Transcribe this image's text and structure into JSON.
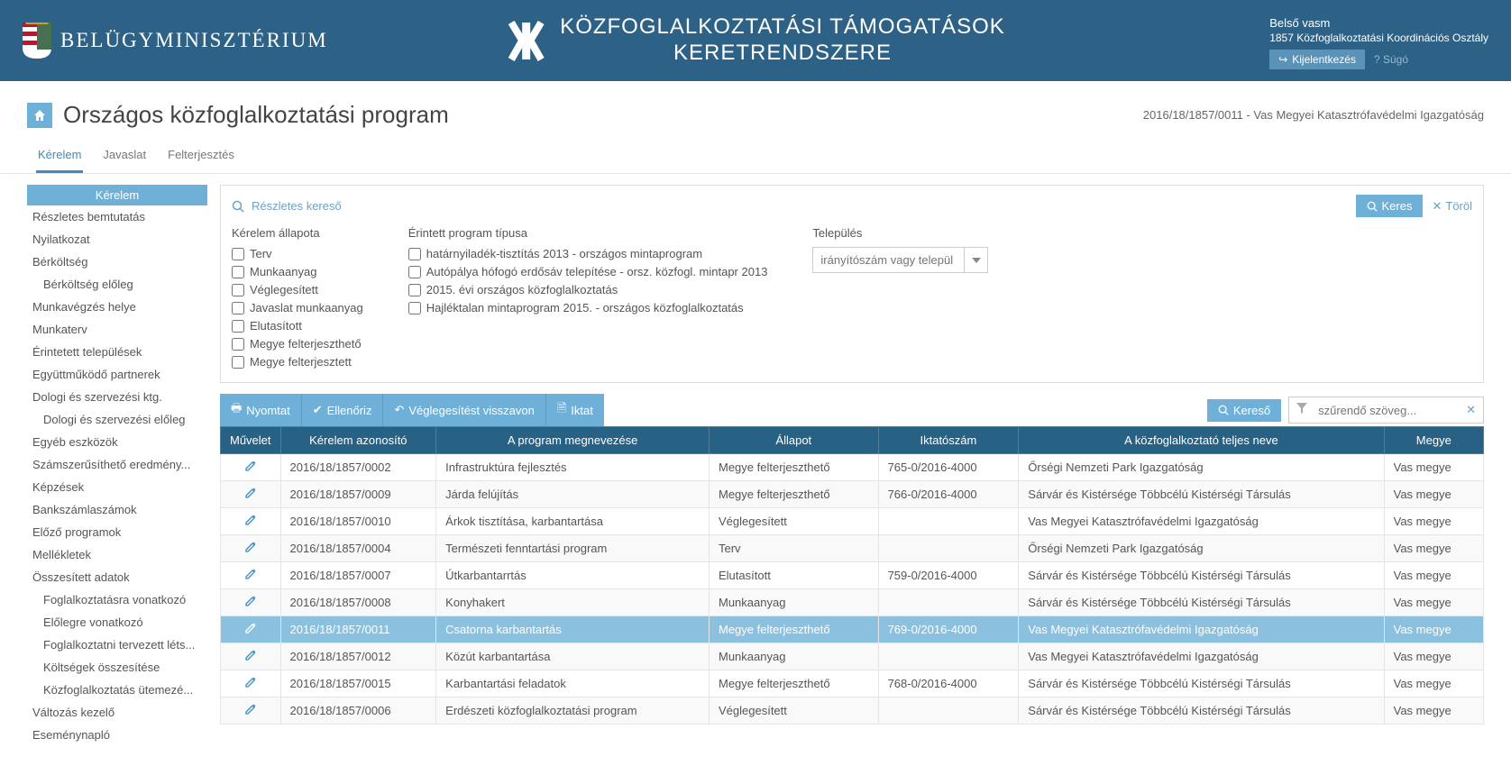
{
  "header": {
    "ministry": "BELÜGYMINISZTÉRIUM",
    "app_title_line1": "KÖZFOGLALKOZTATÁSI TÁMOGATÁSOK",
    "app_title_line2": "KERETRENDSZERE",
    "user_name": "Belső vasm",
    "user_org": "1857 Közfoglalkoztatási Koordinációs Osztály",
    "logout_label": "Kijelentkezés",
    "help_label": "? Súgó"
  },
  "page": {
    "title": "Országos közfoglalkoztatási program",
    "context": "2016/18/1857/0011 - Vas Megyei Katasztrófavédelmi Igazgatóság"
  },
  "tabs": [
    {
      "label": "Kérelem",
      "active": true
    },
    {
      "label": "Javaslat",
      "active": false
    },
    {
      "label": "Felterjesztés",
      "active": false
    }
  ],
  "sidebar": {
    "header": "Kérelem",
    "items": [
      {
        "label": "Részletes bemtutatás"
      },
      {
        "label": "Nyilatkozat"
      },
      {
        "label": "Bérköltség"
      },
      {
        "label": "Bérköltség előleg",
        "indent": true
      },
      {
        "label": "Munkavégzés helye"
      },
      {
        "label": "Munkaterv"
      },
      {
        "label": "Érintetett települések"
      },
      {
        "label": "Együttműködő partnerek"
      },
      {
        "label": "Dologi és szervezési ktg."
      },
      {
        "label": "Dologi és szervezési előleg",
        "indent": true
      },
      {
        "label": "Egyéb eszközök"
      },
      {
        "label": "Számszerűsíthető eredmény..."
      },
      {
        "label": "Képzések"
      },
      {
        "label": "Bankszámlaszámok"
      },
      {
        "label": "Előző programok"
      },
      {
        "label": "Mellékletek"
      },
      {
        "label": "Összesített adatok"
      },
      {
        "label": "Foglalkoztatásra vonatkozó",
        "indent": true
      },
      {
        "label": "Előlegre vonatkozó",
        "indent": true
      },
      {
        "label": "Foglalkoztatni tervezett léts...",
        "indent": true
      },
      {
        "label": "Költségek összesítése",
        "indent": true
      },
      {
        "label": "Közfoglalkoztatás ütemezé...",
        "indent": true
      },
      {
        "label": "Változás kezelő"
      },
      {
        "label": "Eseménynapló"
      }
    ]
  },
  "search": {
    "label": "Részletes kereső",
    "search_btn": "Keres",
    "clear_btn": "Töröl",
    "status_title": "Kérelem állapota",
    "status_options": [
      "Terv",
      "Munkaanyag",
      "Véglegesített",
      "Javaslat munkaanyag",
      "Elutasított",
      "Megye felterjeszthető",
      "Megye felterjesztett"
    ],
    "program_title": "Érintett program típusa",
    "program_options": [
      "határnyiladék-tisztítás 2013 - országos mintaprogram",
      "Autópálya hófogó erdősáv telepítése - orsz. közfogl. mintapr 2013",
      "2015. évi országos közfoglalkoztatás",
      "Hajléktalan mintaprogram 2015. - országos közfoglalkoztatás"
    ],
    "town_title": "Település",
    "town_placeholder": "irányítószám vagy települ"
  },
  "toolbar": {
    "print": "Nyomtat",
    "check": "Ellenőriz",
    "revoke": "Véglegesítést visszavon",
    "file": "Iktat",
    "search": "Kereső",
    "filter_placeholder": "szűrendő szöveg..."
  },
  "table": {
    "headers": [
      "Művelet",
      "Kérelem azonosító",
      "A program megnevezése",
      "Állapot",
      "Iktatószám",
      "A közfoglalkoztató teljes neve",
      "Megye"
    ],
    "rows": [
      {
        "id": "2016/18/1857/0002",
        "name": "Infrastruktúra fejlesztés",
        "status": "Megye felterjeszthető",
        "reg": "765-0/2016-4000",
        "org": "Őrségi Nemzeti Park Igazgatóság",
        "county": "Vas megye"
      },
      {
        "id": "2016/18/1857/0009",
        "name": "Járda felújítás",
        "status": "Megye felterjeszthető",
        "reg": "766-0/2016-4000",
        "org": "Sárvár és Kistérsége Többcélú Kistérségi Társulás",
        "county": "Vas megye"
      },
      {
        "id": "2016/18/1857/0010",
        "name": "Árkok tisztítása, karbantartása",
        "status": "Véglegesített",
        "reg": "",
        "org": "Vas Megyei Katasztrófavédelmi Igazgatóság",
        "county": "Vas megye"
      },
      {
        "id": "2016/18/1857/0004",
        "name": "Természeti fenntartási program",
        "status": "Terv",
        "reg": "",
        "org": "Őrségi Nemzeti Park Igazgatóság",
        "county": "Vas megye"
      },
      {
        "id": "2016/18/1857/0007",
        "name": "Útkarbantarrtás",
        "status": "Elutasított",
        "reg": "759-0/2016-4000",
        "org": "Sárvár és Kistérsége Többcélú Kistérségi Társulás",
        "county": "Vas megye"
      },
      {
        "id": "2016/18/1857/0008",
        "name": "Konyhakert",
        "status": "Munkaanyag",
        "reg": "",
        "org": "Sárvár és Kistérsége Többcélú Kistérségi Társulás",
        "county": "Vas megye"
      },
      {
        "id": "2016/18/1857/0011",
        "name": "Csatorna karbantartás",
        "status": "Megye felterjeszthető",
        "reg": "769-0/2016-4000",
        "org": "Vas Megyei Katasztrófavédelmi Igazgatóság",
        "county": "Vas megye",
        "selected": true
      },
      {
        "id": "2016/18/1857/0012",
        "name": "Közút karbantartása",
        "status": "Munkaanyag",
        "reg": "",
        "org": "Vas Megyei Katasztrófavédelmi Igazgatóság",
        "county": "Vas megye"
      },
      {
        "id": "2016/18/1857/0015",
        "name": "Karbantartási feladatok",
        "status": "Megye felterjeszthető",
        "reg": "768-0/2016-4000",
        "org": "Sárvár és Kistérsége Többcélú Kistérségi Társulás",
        "county": "Vas megye"
      },
      {
        "id": "2016/18/1857/0006",
        "name": "Erdészeti közfoglalkoztatási program",
        "status": "Véglegesített",
        "reg": "",
        "org": "Sárvár és Kistérsége Többcélú Kistérségi Társulás",
        "county": "Vas megye"
      }
    ]
  }
}
